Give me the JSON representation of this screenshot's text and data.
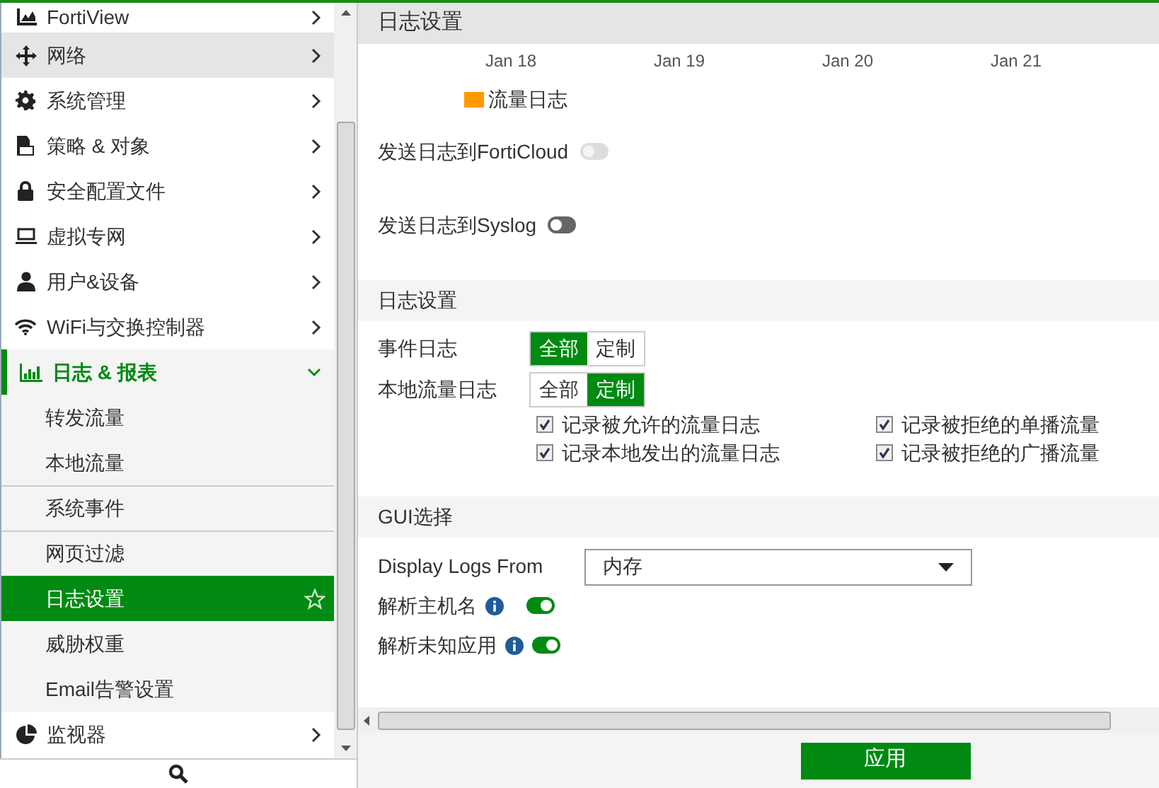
{
  "sidebar": {
    "items": [
      {
        "label": "FortiView",
        "hovered": false,
        "expanded": false
      },
      {
        "label": "网络",
        "hovered": true,
        "expanded": false
      },
      {
        "label": "系统管理",
        "hovered": false,
        "expanded": false
      },
      {
        "label": "策略 & 对象",
        "hovered": false,
        "expanded": false
      },
      {
        "label": "安全配置文件",
        "hovered": false,
        "expanded": false
      },
      {
        "label": "虚拟专网",
        "hovered": false,
        "expanded": false
      },
      {
        "label": "用户&设备",
        "hovered": false,
        "expanded": false
      },
      {
        "label": "WiFi与交换控制器",
        "hovered": false,
        "expanded": false
      },
      {
        "label": "日志 & 报表",
        "hovered": false,
        "expanded": true,
        "children": [
          {
            "label": "转发流量",
            "selected": false
          },
          {
            "label": "本地流量",
            "selected": false
          },
          {
            "label": "系统事件",
            "selected": false
          },
          {
            "label": "网页过滤",
            "selected": false
          },
          {
            "label": "日志设置",
            "selected": true
          },
          {
            "label": "威胁权重",
            "selected": false
          },
          {
            "label": "Email告警设置",
            "selected": false
          }
        ]
      },
      {
        "label": "监视器",
        "hovered": false,
        "expanded": false
      }
    ]
  },
  "header": {
    "title": "日志设置"
  },
  "chart": {
    "x_labels": [
      "Jan 18",
      "Jan 19",
      "Jan 20",
      "Jan 21"
    ],
    "legend": [
      {
        "label": "流量日志",
        "color": "#ff9900"
      }
    ]
  },
  "remote": [
    {
      "label": "发送日志到FortiCloud",
      "on": false,
      "disabled": true
    },
    {
      "label": "发送日志到Syslog",
      "on": false,
      "disabled": false
    }
  ],
  "log_settings": {
    "title": "日志设置",
    "rows": [
      {
        "label": "事件日志",
        "options": [
          {
            "label": "全部",
            "selected": true
          },
          {
            "label": "定制",
            "selected": false
          }
        ]
      },
      {
        "label": "本地流量日志",
        "options": [
          {
            "label": "全部",
            "selected": false
          },
          {
            "label": "定制",
            "selected": true
          }
        ]
      }
    ],
    "checkboxes": [
      {
        "label": "记录被允许的流量日志",
        "checked": true
      },
      {
        "label": "记录被拒绝的单播流量",
        "checked": true
      },
      {
        "label": "记录本地发出的流量日志",
        "checked": true
      },
      {
        "label": "记录被拒绝的广播流量",
        "checked": true
      }
    ]
  },
  "gui": {
    "title": "GUI选择",
    "display_label": "Display Logs From",
    "display_value": "内存",
    "toggles": [
      {
        "label": "解析主机名",
        "on": true
      },
      {
        "label": "解析未知应用",
        "on": true
      }
    ]
  },
  "apply_button": "应用"
}
